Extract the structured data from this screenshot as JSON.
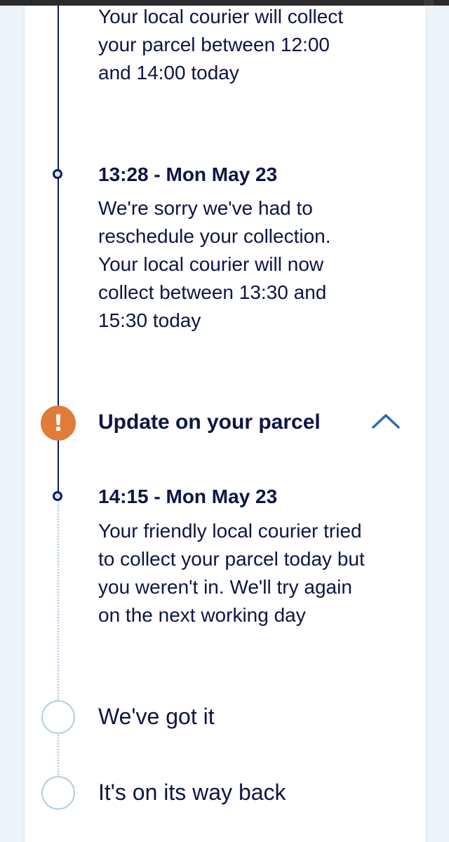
{
  "timeline": {
    "prior_event": {
      "message": "Your local courier will collect your parcel between 12:00 and 14:00 today"
    },
    "rescheduled_event": {
      "timestamp": "13:28 - Mon May 23",
      "message": "We're sorry we've had to reschedule your collection. Your local courier will now collect between 13:30 and 15:30 today"
    },
    "update_section": {
      "icon": "exclamation-icon",
      "title": "Update on your parcel",
      "toggle_icon": "chevron-up-icon",
      "expanded": true
    },
    "missed_event": {
      "timestamp": "14:15 - Mon May 23",
      "message": "Your friendly local courier tried to collect your parcel today but you weren't in. We'll try again on the next working day"
    },
    "pending_steps": [
      {
        "label": "We've got it"
      },
      {
        "label": "It's on its way back"
      }
    ]
  },
  "colors": {
    "text_navy": "#0d1545",
    "timeline_navy": "#0d1a5c",
    "alert_orange": "#e07b3a",
    "chevron_blue": "#2d6cb5",
    "pending_ring": "#b3cde2"
  }
}
